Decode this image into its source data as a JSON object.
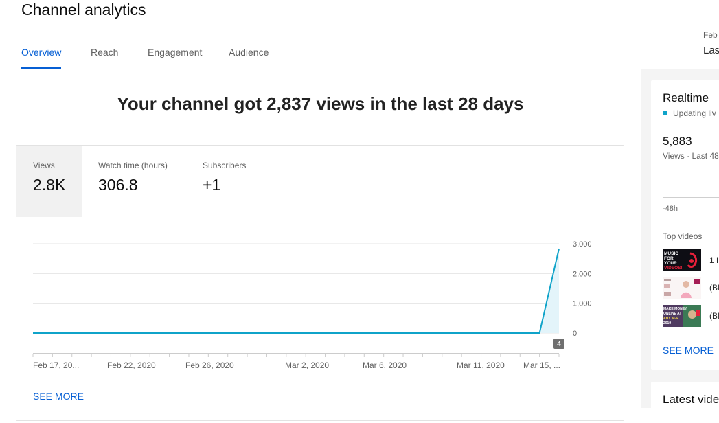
{
  "header": {
    "title": "Channel analytics",
    "tabs": [
      {
        "label": "Overview",
        "active": true
      },
      {
        "label": "Reach",
        "active": false
      },
      {
        "label": "Engagement",
        "active": false
      },
      {
        "label": "Audience",
        "active": false
      }
    ],
    "date_range": {
      "subtitle": "Feb",
      "label": "Las"
    }
  },
  "main": {
    "headline": "Your channel got 2,837 views in the last 28 days",
    "metrics": [
      {
        "label": "Views",
        "value": "2.8K",
        "selected": true
      },
      {
        "label": "Watch time (hours)",
        "value": "306.8",
        "selected": false
      },
      {
        "label": "Subscribers",
        "value": "+1",
        "selected": false
      }
    ],
    "see_more": "SEE MORE"
  },
  "chart_data": {
    "type": "area",
    "x": [
      "Feb 17, 20...",
      "Feb 22, 2020",
      "Feb 26, 2020",
      "Mar 2, 2020",
      "Mar 6, 2020",
      "Mar 11, 2020",
      "Mar 15, ..."
    ],
    "y_ticks": [
      "0",
      "1,000",
      "2,000",
      "3,000"
    ],
    "ylim": [
      0,
      3000
    ],
    "series": [
      {
        "values": [
          0,
          0,
          0,
          0,
          0,
          0,
          0,
          0,
          0,
          0,
          0,
          0,
          0,
          0,
          0,
          0,
          0,
          0,
          0,
          0,
          0,
          0,
          0,
          0,
          0,
          0,
          0,
          2837
        ]
      }
    ],
    "marker_badge": "4",
    "grid": true,
    "line_color": "#0fa3c9",
    "fill_color": "#e3f4fa"
  },
  "realtime": {
    "title": "Realtime",
    "status": "Updating liv",
    "count": "5,883",
    "count_label": "Views · Last 48",
    "axis_label": "-48h",
    "top_videos_label": "Top videos",
    "videos": [
      {
        "title": "1 H",
        "thumb_icon": "music-thumbnail"
      },
      {
        "title": "(Bl",
        "thumb_icon": "portrait-thumbnail"
      },
      {
        "title": "(Bl",
        "thumb_icon": "money-thumbnail"
      }
    ],
    "thumb_texts": {
      "music": [
        "MUSIC",
        "FOR",
        "YOUR",
        "VIDEOS!"
      ],
      "money": [
        "MAKE MONEY",
        "ONLINE AT",
        "ANY AGE",
        "2019"
      ]
    },
    "see_more": "SEE MORE"
  },
  "latest": {
    "title": "Latest vide"
  },
  "colors": {
    "accent": "#065fd4",
    "chart_line": "#0fa3c9",
    "live_dot": "#0fa3c9"
  }
}
